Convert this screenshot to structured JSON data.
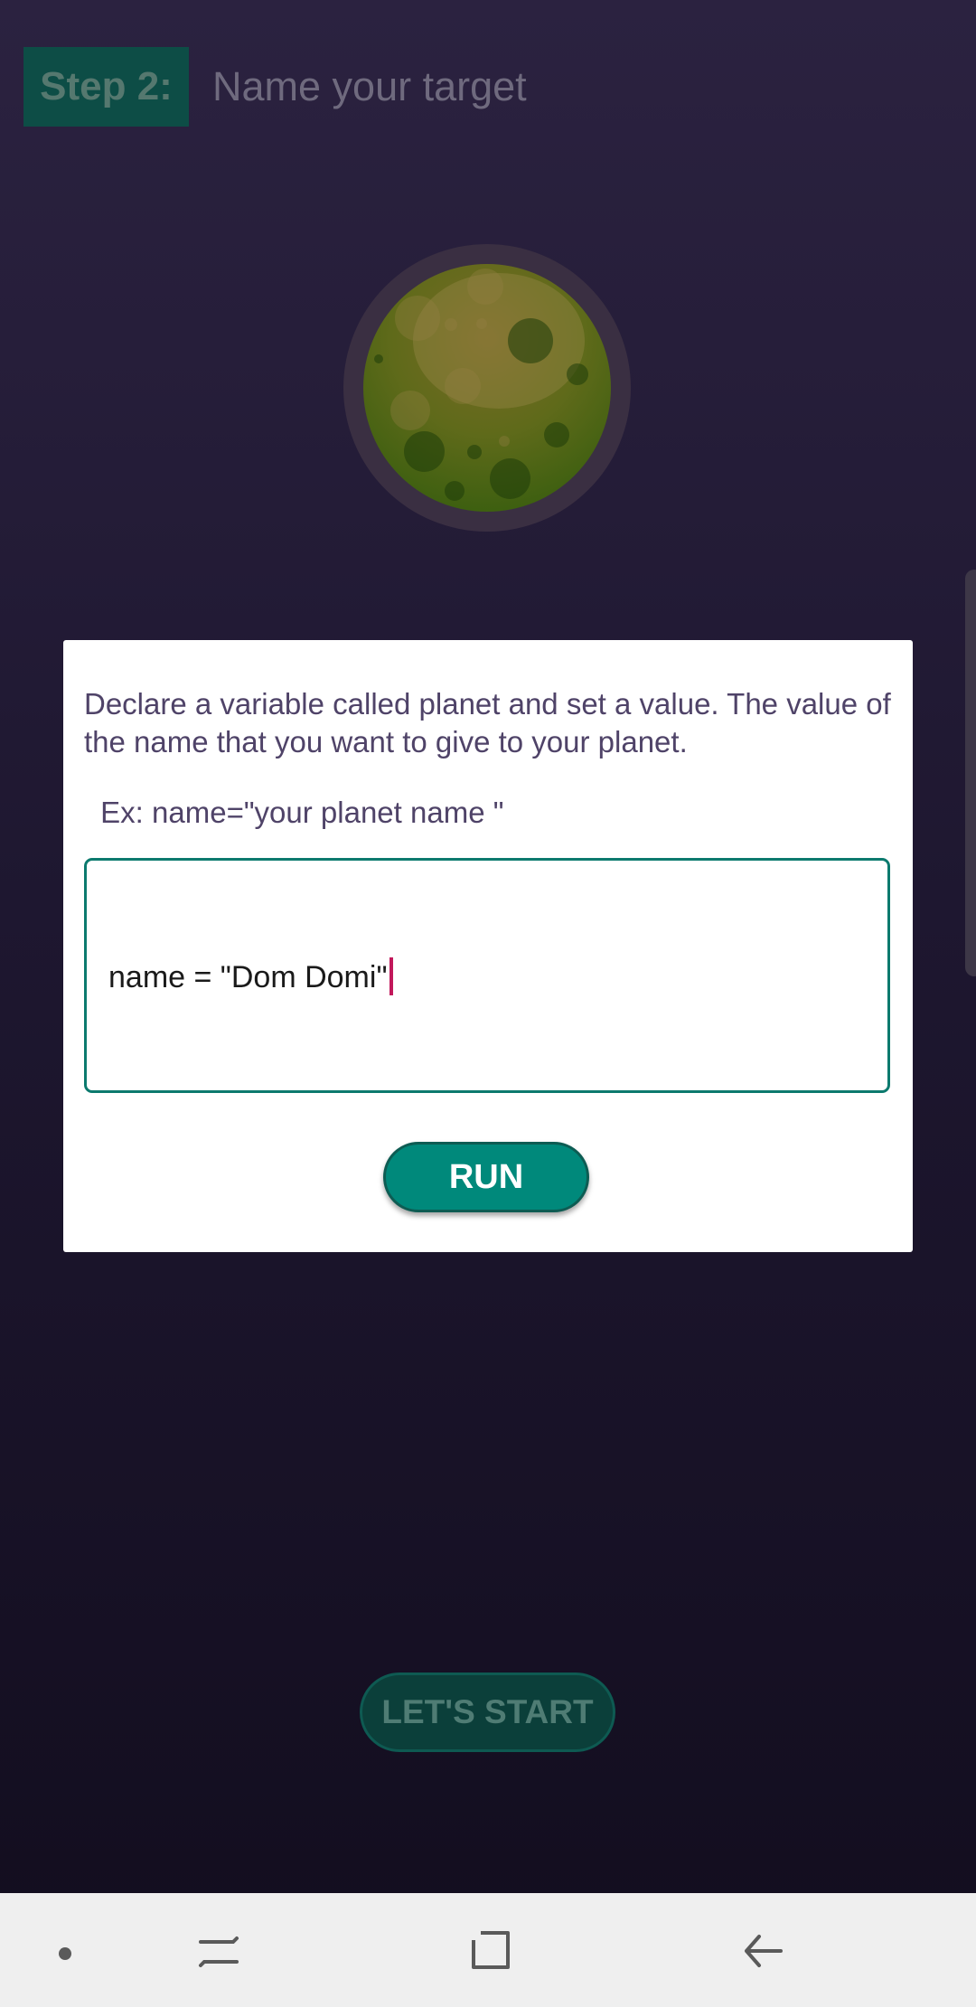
{
  "header": {
    "step_label": "Step 2:",
    "title": "Name your target"
  },
  "planet": {
    "icon": "planet-illustration"
  },
  "dialog": {
    "message": "Declare a variable called planet and set a value. The value of the name that you want to give to your planet.",
    "example": " Ex: name=\"your planet name \"",
    "code_value": "name = \"Dom Domi\"",
    "run_label": "RUN"
  },
  "main": {
    "start_label": "LET'S START"
  },
  "navbar": {
    "icons": [
      "home-dot-icon",
      "recent-apps-icon",
      "overview-icon",
      "back-icon"
    ]
  },
  "colors": {
    "accent": "#00897b",
    "dialog_text": "#4f4368",
    "caret": "#c2185b"
  }
}
